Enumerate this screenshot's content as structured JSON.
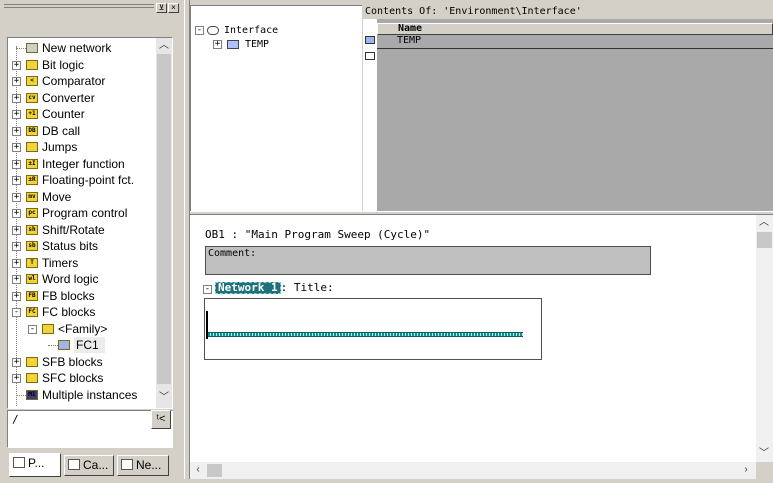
{
  "catalog": {
    "items": [
      {
        "label": "New network",
        "icon": "NEW",
        "expandable": false
      },
      {
        "label": "Bit logic",
        "icon": "-||-",
        "expandable": true
      },
      {
        "label": "Comparator",
        "icon": "<",
        "expandable": true
      },
      {
        "label": "Converter",
        "icon": "cv",
        "expandable": true
      },
      {
        "label": "Counter",
        "icon": "+1",
        "expandable": true
      },
      {
        "label": "DB call",
        "icon": "DB",
        "expandable": true
      },
      {
        "label": "Jumps",
        "icon": "JMP",
        "expandable": true
      },
      {
        "label": "Integer function",
        "icon": "±I",
        "expandable": true
      },
      {
        "label": "Floating-point fct.",
        "icon": "±R",
        "expandable": true
      },
      {
        "label": "Move",
        "icon": "mv",
        "expandable": true
      },
      {
        "label": "Program control",
        "icon": "pc",
        "expandable": true
      },
      {
        "label": "Shift/Rotate",
        "icon": "sh",
        "expandable": true
      },
      {
        "label": "Status bits",
        "icon": "sb",
        "expandable": true
      },
      {
        "label": "Timers",
        "icon": "T",
        "expandable": true
      },
      {
        "label": "Word logic",
        "icon": "wl",
        "expandable": true
      },
      {
        "label": "FB blocks",
        "icon": "FB",
        "expandable": true
      },
      {
        "label": "FC blocks",
        "icon": "FC",
        "expandable": true,
        "expanded": true
      },
      {
        "label": "<Family>",
        "icon": "FAM",
        "expandable": true,
        "expanded": true,
        "level": 1
      },
      {
        "label": "FC1",
        "icon": "blk",
        "expandable": false,
        "level": 2,
        "selected": true
      },
      {
        "label": "SFB blocks",
        "icon": "SFB",
        "expandable": true
      },
      {
        "label": "SFC blocks",
        "icon": "SFC",
        "expandable": true
      },
      {
        "label": "Multiple instances",
        "icon": "MI",
        "expandable": false
      }
    ],
    "info_text": "/",
    "info_button_label": "ᵗ<"
  },
  "tabs": [
    {
      "label": "P...",
      "active": true
    },
    {
      "label": "Ca...",
      "active": false
    },
    {
      "label": "Ne...",
      "active": false
    }
  ],
  "interface": {
    "root": "Interface",
    "child": "TEMP",
    "contents_title": "Contents Of: 'Environment\\Interface'",
    "column_name": "Name",
    "rows": [
      "TEMP"
    ]
  },
  "code": {
    "block_title": "OB1 :   \"Main Program Sweep (Cycle)\"",
    "comment_label": "Comment:",
    "network_label": "Network 1",
    "network_title": ": Title:"
  }
}
